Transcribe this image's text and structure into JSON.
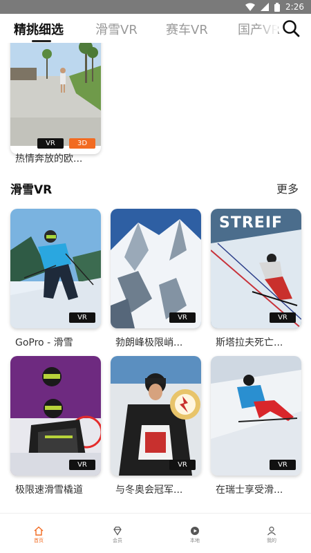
{
  "status_bar": {
    "time": "2:26"
  },
  "tabs": [
    {
      "label": "精挑细选",
      "active": true
    },
    {
      "label": "滑雪VR",
      "active": false
    },
    {
      "label": "赛车VR",
      "active": false
    },
    {
      "label": "国产VR",
      "active": false
    }
  ],
  "top_card": {
    "title": "热情奔放的欧...",
    "badges": [
      "VR",
      "3D"
    ]
  },
  "section": {
    "title": "滑雪VR",
    "more": "更多"
  },
  "cards": [
    {
      "title": "GoPro - 滑雪",
      "badge": "VR"
    },
    {
      "title": "勃朗峰极限峭...",
      "badge": "VR"
    },
    {
      "title": "斯塔拉夫死亡...",
      "badge": "VR",
      "overlay_text": "STREIF"
    },
    {
      "title": "极限速滑雪橇道",
      "badge": "VR"
    },
    {
      "title": "与冬奥会冠军...",
      "badge": "VR"
    },
    {
      "title": "在瑞士享受滑...",
      "badge": "VR"
    }
  ],
  "bottom_nav": [
    {
      "label": "首页",
      "icon": "home-icon",
      "active": true
    },
    {
      "label": "会员",
      "icon": "diamond-icon",
      "active": false
    },
    {
      "label": "本地",
      "icon": "play-circle-icon",
      "active": false
    },
    {
      "label": "我的",
      "icon": "user-icon",
      "active": false
    }
  ],
  "colors": {
    "accent": "#f26b21",
    "status_bar": "#7a7a7a",
    "badge_vr": "#111111"
  }
}
